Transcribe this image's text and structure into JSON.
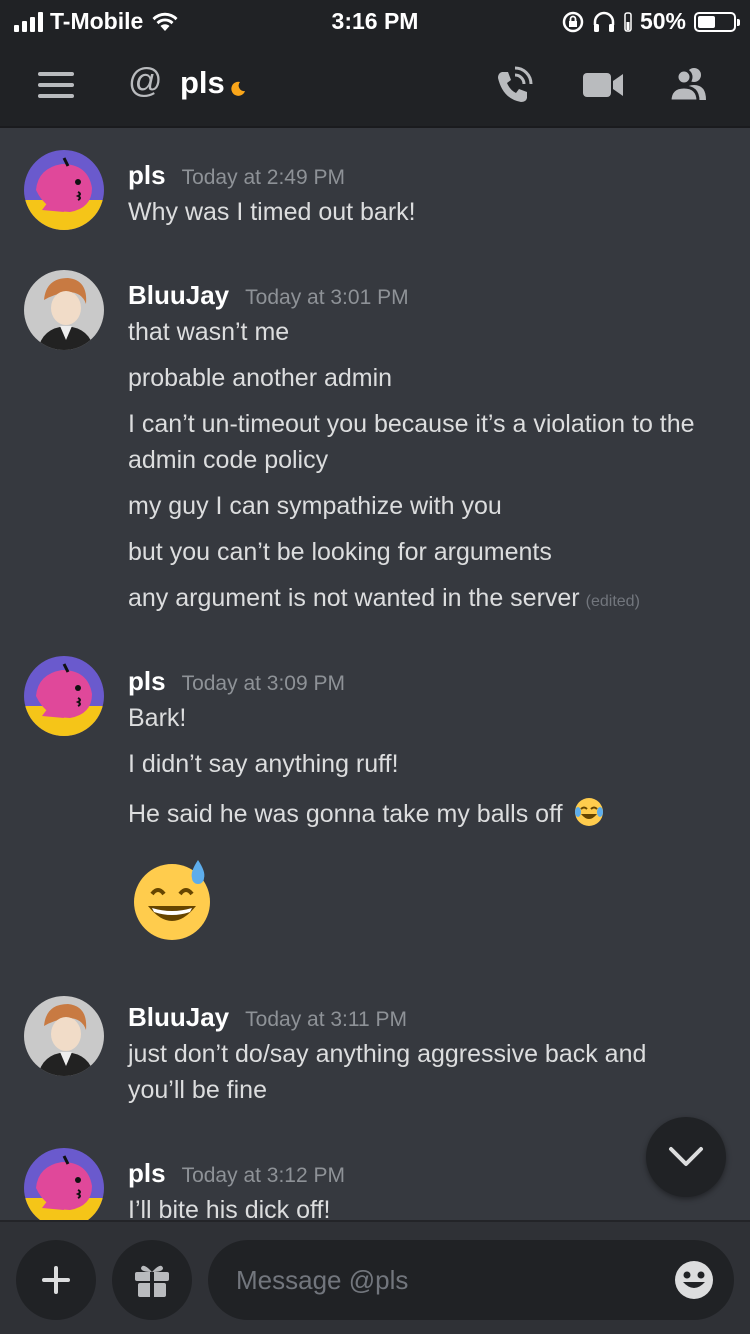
{
  "status_bar": {
    "carrier": "T-Mobile",
    "time": "3:16 PM",
    "battery": "50%",
    "battery_level": 0.5
  },
  "header": {
    "title": "pls",
    "icons": [
      "menu-icon",
      "at-icon",
      "idle-moon-icon",
      "voice-call-icon",
      "video-call-icon",
      "members-icon"
    ]
  },
  "messages": [
    {
      "author": "pls",
      "timestamp": "Today at 2:49 PM",
      "lines": [
        "Why was I timed out bark!"
      ]
    },
    {
      "author": "BluuJay",
      "timestamp": "Today at 3:01 PM",
      "lines": [
        "that wasn’t me",
        "probable another admin",
        "I can’t un-timeout you because it’s a violation to the admin code policy",
        "my guy I can sympathize with you",
        "but you can’t be looking for arguments",
        "any argument is not wanted in the server"
      ],
      "edited_label": "(edited)"
    },
    {
      "author": "pls",
      "timestamp": "Today at 3:09 PM",
      "lines": [
        "Bark!",
        "I didn’t say anything ruff!",
        "He said he was gonna take my balls off"
      ],
      "emoji": [
        "joy-emoji",
        "grinning-sweat-emoji"
      ]
    },
    {
      "author": "BluuJay",
      "timestamp": "Today at 3:11 PM",
      "lines": [
        "just don’t do/say anything aggressive back and you’ll be fine"
      ]
    },
    {
      "author": "pls",
      "timestamp": "Today at 3:12 PM",
      "lines": [
        "I’ll bite his dick off!"
      ]
    }
  ],
  "composer": {
    "placeholder": "Message @pls"
  },
  "colors": {
    "background": "#36393f",
    "header": "#202225",
    "text": "#dcddde",
    "muted": "#8e9297"
  }
}
